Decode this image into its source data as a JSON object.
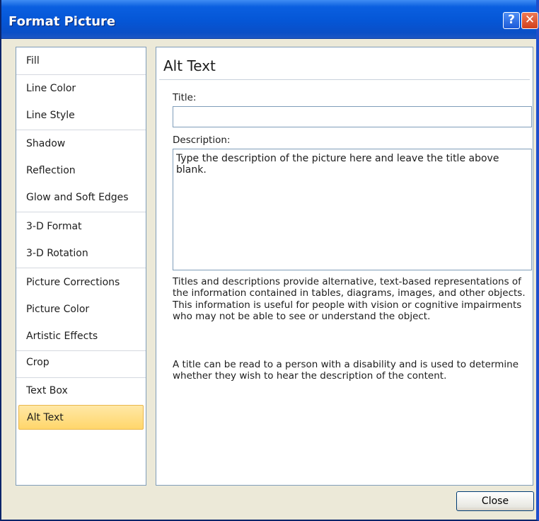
{
  "window": {
    "title": "Format Picture",
    "help_glyph": "?",
    "close_glyph": "✕"
  },
  "nav": {
    "items": [
      {
        "label": "Fill"
      },
      {
        "label": "Line Color"
      },
      {
        "label": "Line Style"
      },
      {
        "label": "Shadow"
      },
      {
        "label": "Reflection"
      },
      {
        "label": "Glow and Soft Edges"
      },
      {
        "label": "3-D Format"
      },
      {
        "label": "3-D Rotation"
      },
      {
        "label": "Picture Corrections"
      },
      {
        "label": "Picture Color"
      },
      {
        "label": "Artistic Effects"
      },
      {
        "label": "Crop"
      },
      {
        "label": "Text Box"
      },
      {
        "label": "Alt Text",
        "selected": true
      }
    ]
  },
  "panel": {
    "header": "Alt Text",
    "title_label": "Title:",
    "title_value": "",
    "description_label": "Description:",
    "description_value": "Type the description of the picture here and leave the title above blank.",
    "help_text_1": "Titles and descriptions provide alternative, text-based representations of the information contained in tables, diagrams, images, and other objects. This information is useful for people with vision or cognitive impairments who may not be able to see or understand the object.",
    "help_text_2": "A title can be read to a person with a disability and is used to determine whether they wish to hear the description of the content."
  },
  "footer": {
    "close_label": "Close"
  },
  "colors": {
    "titlebar": "#0556d6",
    "selected_item": "#ffd66b",
    "dialog_bg": "#ece9d8"
  }
}
